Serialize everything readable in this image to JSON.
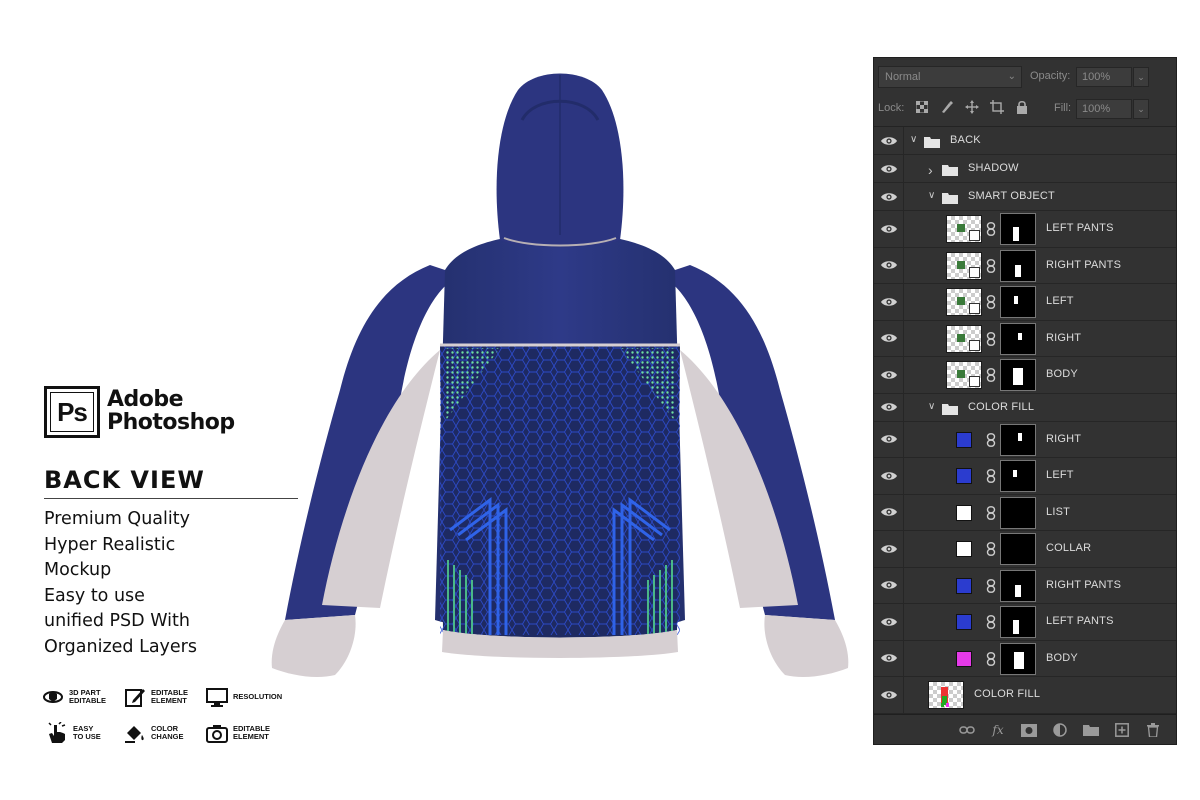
{
  "branding": {
    "logo_text": "Ps",
    "name_line1": "Adobe",
    "name_line2": "Photoshop"
  },
  "view_title": "BACK VIEW",
  "features": [
    "Premium Quality",
    "Hyper Realistic",
    "Mockup",
    "Easy to use",
    "unified PSD With",
    "Organized Layers"
  ],
  "badges": [
    {
      "icon": "3d-part-icon",
      "line1": "3D PART",
      "line2": "EDITABLE"
    },
    {
      "icon": "editable-element-icon",
      "line1": "EDITABLE",
      "line2": "ELEMENT"
    },
    {
      "icon": "monitor-icon",
      "line1": "RESOLUTION",
      "line2": ""
    },
    {
      "icon": "hand-click-icon",
      "line1": "EASY",
      "line2": "TO USE"
    },
    {
      "icon": "paint-bucket-icon",
      "line1": "COLOR",
      "line2": "CHANGE"
    },
    {
      "icon": "camera-icon",
      "line1": "EDITABLE",
      "line2": "ELEMENT"
    }
  ],
  "garment": {
    "body_color": "#2c3580",
    "panel_color": "#1f2a66",
    "pattern_blue": "#2f4fd6",
    "pattern_green": "#4fc78a",
    "sleeve_light": "#d6cfd2"
  },
  "layers_panel": {
    "blend_mode": "Normal",
    "opacity_label": "Opacity:",
    "opacity_value": "100%",
    "lock_label": "Lock:",
    "fill_label": "Fill:",
    "fill_value": "100%",
    "layers": [
      {
        "name": "BACK",
        "kind": "group",
        "expanded": true,
        "indent": 0
      },
      {
        "name": "SHADOW",
        "kind": "group",
        "expanded": false,
        "indent": 1
      },
      {
        "name": "SMART OBJECT",
        "kind": "group",
        "expanded": true,
        "indent": 1
      },
      {
        "name": "LEFT PANTS",
        "kind": "smart",
        "indent": 2
      },
      {
        "name": "RIGHT PANTS",
        "kind": "smart",
        "indent": 2
      },
      {
        "name": "LEFT",
        "kind": "smart",
        "indent": 2
      },
      {
        "name": "RIGHT",
        "kind": "smart",
        "indent": 2
      },
      {
        "name": "BODY",
        "kind": "smart",
        "indent": 2
      },
      {
        "name": "COLOR FILL",
        "kind": "group",
        "expanded": true,
        "indent": 1
      },
      {
        "name": "RIGHT",
        "kind": "fill",
        "color": "#2b3ccf",
        "indent": 2
      },
      {
        "name": "LEFT",
        "kind": "fill",
        "color": "#2b3ccf",
        "indent": 2
      },
      {
        "name": "LIST",
        "kind": "fill",
        "color": "#ffffff",
        "indent": 2
      },
      {
        "name": "COLLAR",
        "kind": "fill",
        "color": "#ffffff",
        "indent": 2
      },
      {
        "name": "RIGHT PANTS",
        "kind": "fill",
        "color": "#2b3ccf",
        "indent": 2
      },
      {
        "name": "LEFT PANTS",
        "kind": "fill",
        "color": "#2b3ccf",
        "indent": 2
      },
      {
        "name": "BODY",
        "kind": "fill",
        "color": "#e53ae8",
        "indent": 2
      },
      {
        "name": "COLOR FILL",
        "kind": "smart",
        "indent": 1
      }
    ]
  }
}
